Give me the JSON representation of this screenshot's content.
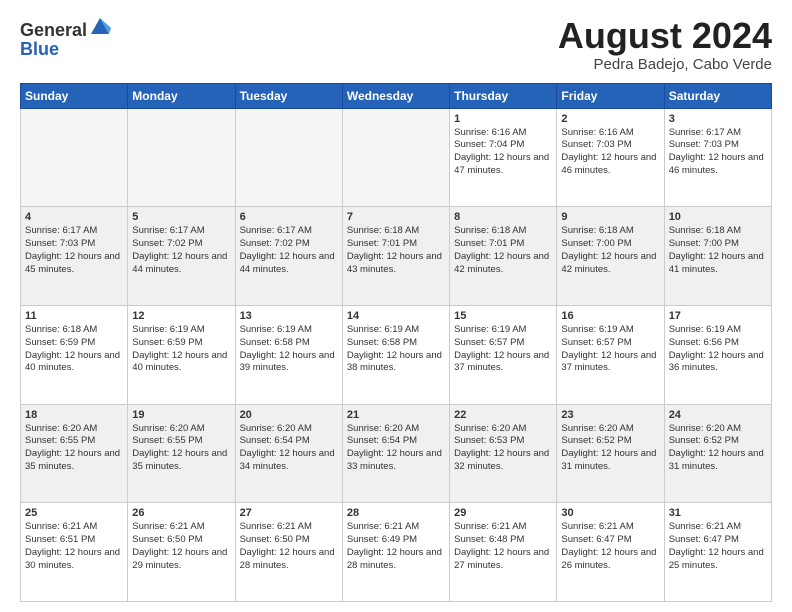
{
  "header": {
    "logo_line1": "General",
    "logo_line2": "Blue",
    "month_year": "August 2024",
    "location": "Pedra Badejo, Cabo Verde"
  },
  "days_of_week": [
    "Sunday",
    "Monday",
    "Tuesday",
    "Wednesday",
    "Thursday",
    "Friday",
    "Saturday"
  ],
  "weeks": [
    [
      {
        "day": "",
        "content": ""
      },
      {
        "day": "",
        "content": ""
      },
      {
        "day": "",
        "content": ""
      },
      {
        "day": "",
        "content": ""
      },
      {
        "day": "1",
        "content": "Sunrise: 6:16 AM\nSunset: 7:04 PM\nDaylight: 12 hours\nand 47 minutes."
      },
      {
        "day": "2",
        "content": "Sunrise: 6:16 AM\nSunset: 7:03 PM\nDaylight: 12 hours\nand 46 minutes."
      },
      {
        "day": "3",
        "content": "Sunrise: 6:17 AM\nSunset: 7:03 PM\nDaylight: 12 hours\nand 46 minutes."
      }
    ],
    [
      {
        "day": "4",
        "content": "Sunrise: 6:17 AM\nSunset: 7:03 PM\nDaylight: 12 hours\nand 45 minutes."
      },
      {
        "day": "5",
        "content": "Sunrise: 6:17 AM\nSunset: 7:02 PM\nDaylight: 12 hours\nand 44 minutes."
      },
      {
        "day": "6",
        "content": "Sunrise: 6:17 AM\nSunset: 7:02 PM\nDaylight: 12 hours\nand 44 minutes."
      },
      {
        "day": "7",
        "content": "Sunrise: 6:18 AM\nSunset: 7:01 PM\nDaylight: 12 hours\nand 43 minutes."
      },
      {
        "day": "8",
        "content": "Sunrise: 6:18 AM\nSunset: 7:01 PM\nDaylight: 12 hours\nand 42 minutes."
      },
      {
        "day": "9",
        "content": "Sunrise: 6:18 AM\nSunset: 7:00 PM\nDaylight: 12 hours\nand 42 minutes."
      },
      {
        "day": "10",
        "content": "Sunrise: 6:18 AM\nSunset: 7:00 PM\nDaylight: 12 hours\nand 41 minutes."
      }
    ],
    [
      {
        "day": "11",
        "content": "Sunrise: 6:18 AM\nSunset: 6:59 PM\nDaylight: 12 hours\nand 40 minutes."
      },
      {
        "day": "12",
        "content": "Sunrise: 6:19 AM\nSunset: 6:59 PM\nDaylight: 12 hours\nand 40 minutes."
      },
      {
        "day": "13",
        "content": "Sunrise: 6:19 AM\nSunset: 6:58 PM\nDaylight: 12 hours\nand 39 minutes."
      },
      {
        "day": "14",
        "content": "Sunrise: 6:19 AM\nSunset: 6:58 PM\nDaylight: 12 hours\nand 38 minutes."
      },
      {
        "day": "15",
        "content": "Sunrise: 6:19 AM\nSunset: 6:57 PM\nDaylight: 12 hours\nand 37 minutes."
      },
      {
        "day": "16",
        "content": "Sunrise: 6:19 AM\nSunset: 6:57 PM\nDaylight: 12 hours\nand 37 minutes."
      },
      {
        "day": "17",
        "content": "Sunrise: 6:19 AM\nSunset: 6:56 PM\nDaylight: 12 hours\nand 36 minutes."
      }
    ],
    [
      {
        "day": "18",
        "content": "Sunrise: 6:20 AM\nSunset: 6:55 PM\nDaylight: 12 hours\nand 35 minutes."
      },
      {
        "day": "19",
        "content": "Sunrise: 6:20 AM\nSunset: 6:55 PM\nDaylight: 12 hours\nand 35 minutes."
      },
      {
        "day": "20",
        "content": "Sunrise: 6:20 AM\nSunset: 6:54 PM\nDaylight: 12 hours\nand 34 minutes."
      },
      {
        "day": "21",
        "content": "Sunrise: 6:20 AM\nSunset: 6:54 PM\nDaylight: 12 hours\nand 33 minutes."
      },
      {
        "day": "22",
        "content": "Sunrise: 6:20 AM\nSunset: 6:53 PM\nDaylight: 12 hours\nand 32 minutes."
      },
      {
        "day": "23",
        "content": "Sunrise: 6:20 AM\nSunset: 6:52 PM\nDaylight: 12 hours\nand 31 minutes."
      },
      {
        "day": "24",
        "content": "Sunrise: 6:20 AM\nSunset: 6:52 PM\nDaylight: 12 hours\nand 31 minutes."
      }
    ],
    [
      {
        "day": "25",
        "content": "Sunrise: 6:21 AM\nSunset: 6:51 PM\nDaylight: 12 hours\nand 30 minutes."
      },
      {
        "day": "26",
        "content": "Sunrise: 6:21 AM\nSunset: 6:50 PM\nDaylight: 12 hours\nand 29 minutes."
      },
      {
        "day": "27",
        "content": "Sunrise: 6:21 AM\nSunset: 6:50 PM\nDaylight: 12 hours\nand 28 minutes."
      },
      {
        "day": "28",
        "content": "Sunrise: 6:21 AM\nSunset: 6:49 PM\nDaylight: 12 hours\nand 28 minutes."
      },
      {
        "day": "29",
        "content": "Sunrise: 6:21 AM\nSunset: 6:48 PM\nDaylight: 12 hours\nand 27 minutes."
      },
      {
        "day": "30",
        "content": "Sunrise: 6:21 AM\nSunset: 6:47 PM\nDaylight: 12 hours\nand 26 minutes."
      },
      {
        "day": "31",
        "content": "Sunrise: 6:21 AM\nSunset: 6:47 PM\nDaylight: 12 hours\nand 25 minutes."
      }
    ]
  ]
}
